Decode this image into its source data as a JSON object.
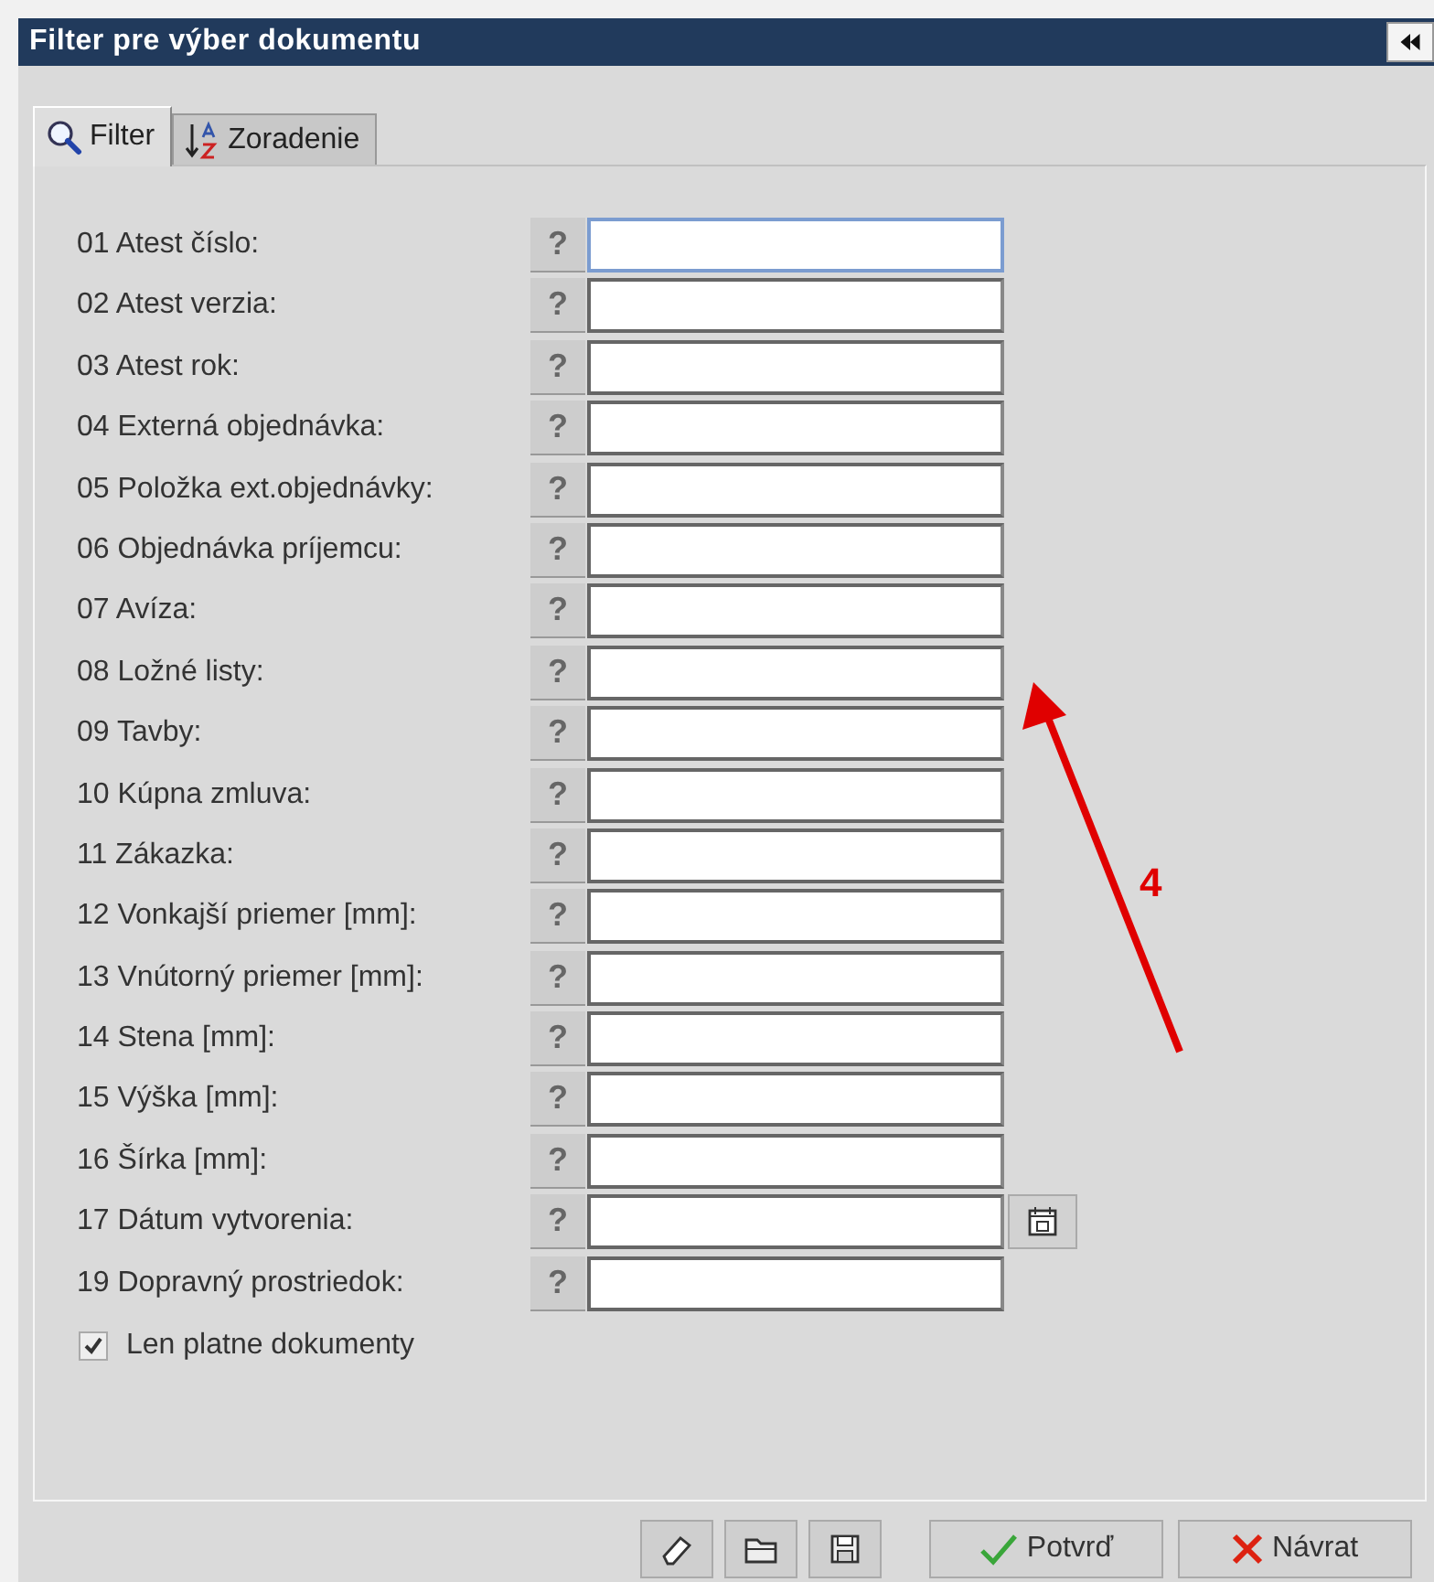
{
  "window": {
    "title": "Filter pre výber dokumentu"
  },
  "tabs": [
    {
      "label": "Filter",
      "selected": true
    },
    {
      "label": "Zoradenie",
      "selected": false
    }
  ],
  "fields": [
    {
      "label": "01 Atest číslo:",
      "help": "?",
      "kind": "text",
      "focused": true
    },
    {
      "label": "02 Atest verzia:",
      "help": "?",
      "kind": "text",
      "focused": false
    },
    {
      "label": "03 Atest rok:",
      "help": "?",
      "kind": "text",
      "focused": false
    },
    {
      "label": "04 Externá objednávka:",
      "help": "?",
      "kind": "text",
      "focused": false
    },
    {
      "label": "05 Položka ext.objednávky:",
      "help": "?",
      "kind": "text",
      "focused": false
    },
    {
      "label": "06 Objednávka príjemcu:",
      "help": "?",
      "kind": "text",
      "focused": false
    },
    {
      "label": "07 Avíza:",
      "help": "?",
      "kind": "text",
      "focused": false
    },
    {
      "label": "08 Ložné listy:",
      "help": "?",
      "kind": "text",
      "focused": false
    },
    {
      "label": "09 Tavby:",
      "help": "?",
      "kind": "text",
      "focused": false
    },
    {
      "label": "10 Kúpna zmluva:",
      "help": "?",
      "kind": "text",
      "focused": false
    },
    {
      "label": "11 Zákazka:",
      "help": "?",
      "kind": "text",
      "focused": false
    },
    {
      "label": "12 Vonkajší priemer [mm]:",
      "help": "?",
      "kind": "text",
      "focused": false
    },
    {
      "label": "13 Vnútorný priemer [mm]:",
      "help": "?",
      "kind": "text",
      "focused": false
    },
    {
      "label": "14 Stena [mm]:",
      "help": "?",
      "kind": "text",
      "focused": false
    },
    {
      "label": "15 Výška [mm]:",
      "help": "?",
      "kind": "text",
      "focused": false
    },
    {
      "label": "16 Šírka [mm]:",
      "help": "?",
      "kind": "text",
      "focused": false
    },
    {
      "label": "17 Dátum vytvorenia:",
      "help": "?",
      "kind": "date",
      "focused": false
    },
    {
      "label": "19 Dopravný prostriedok:",
      "help": "?",
      "kind": "text",
      "focused": false
    }
  ],
  "valid_only": {
    "label": "Len platne dokumenty",
    "checked": true
  },
  "buttons": [
    {
      "label": "Potvrď"
    },
    {
      "label": "Návrat"
    }
  ],
  "annotation": {
    "label": "4"
  }
}
